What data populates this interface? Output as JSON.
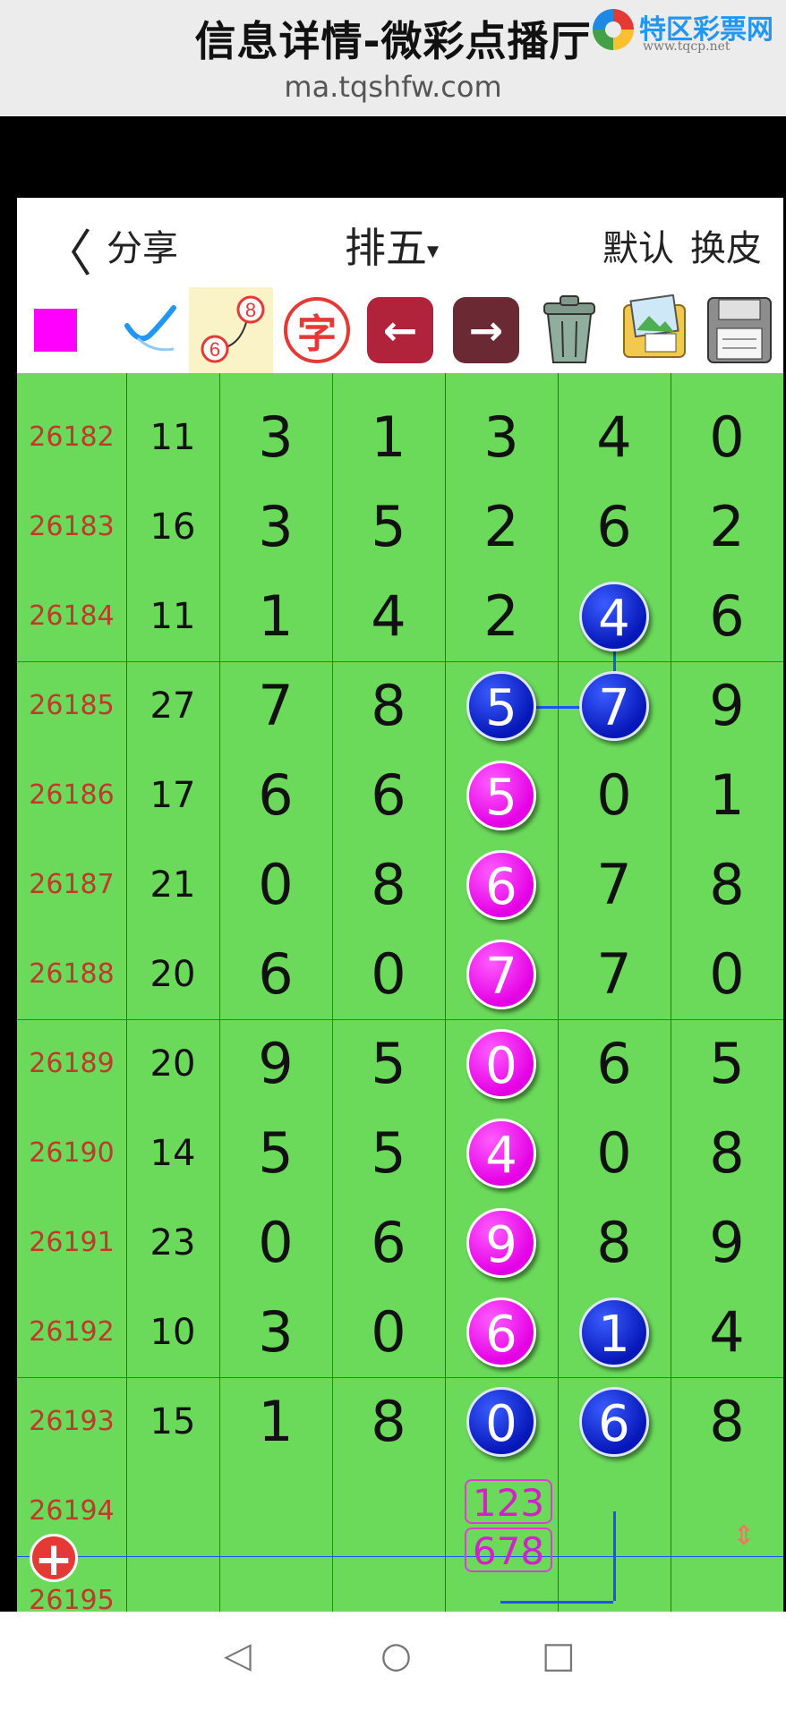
{
  "browser": {
    "title": "信息详情-微彩点播厅",
    "url": "ma.tqshfw.com",
    "logo_text": "特区彩票网",
    "logo_sub": "www.tqcp.net"
  },
  "header": {
    "back_symbol": "〈",
    "share_label": "分享",
    "game_label": "排五",
    "game_caret": "▾",
    "default_label": "默认",
    "skin_label": "换皮"
  },
  "toolbar": {
    "curve_top": "8",
    "curve_bottom": "6",
    "zi_label": "字",
    "prev_symbol": "←",
    "next_symbol": "→",
    "brush_symbol": "✎",
    "trash_symbol": "🗑",
    "photo_symbol": "🖼",
    "save_symbol": "💾"
  },
  "rows": [
    {
      "issue": "26182",
      "sum": "11",
      "digits": [
        "3",
        "1",
        "3",
        "4",
        "0"
      ]
    },
    {
      "issue": "26183",
      "sum": "16",
      "digits": [
        "3",
        "5",
        "2",
        "6",
        "2"
      ]
    },
    {
      "issue": "26184",
      "sum": "11",
      "digits": [
        "1",
        "4",
        "2",
        "4",
        "6"
      ]
    },
    {
      "issue": "26185",
      "sum": "27",
      "digits": [
        "7",
        "8",
        "5",
        "7",
        "9"
      ]
    },
    {
      "issue": "26186",
      "sum": "17",
      "digits": [
        "6",
        "6",
        "5",
        "0",
        "1"
      ]
    },
    {
      "issue": "26187",
      "sum": "21",
      "digits": [
        "0",
        "8",
        "6",
        "7",
        "8"
      ]
    },
    {
      "issue": "26188",
      "sum": "20",
      "digits": [
        "6",
        "0",
        "7",
        "7",
        "0"
      ]
    },
    {
      "issue": "26189",
      "sum": "20",
      "digits": [
        "9",
        "5",
        "0",
        "6",
        "5"
      ]
    },
    {
      "issue": "26190",
      "sum": "14",
      "digits": [
        "5",
        "5",
        "4",
        "0",
        "8"
      ]
    },
    {
      "issue": "26191",
      "sum": "23",
      "digits": [
        "0",
        "6",
        "9",
        "8",
        "9"
      ]
    },
    {
      "issue": "26192",
      "sum": "10",
      "digits": [
        "3",
        "0",
        "6",
        "1",
        "4"
      ]
    },
    {
      "issue": "26193",
      "sum": "15",
      "digits": [
        "1",
        "8",
        "0",
        "6",
        "8"
      ]
    },
    {
      "issue": "26194",
      "sum": "",
      "digits": [
        "",
        "",
        "",
        "",
        ""
      ]
    },
    {
      "issue": "26195",
      "sum": "",
      "digits": [
        "",
        "",
        "",
        "",
        ""
      ]
    }
  ],
  "prediction": {
    "line1": "123",
    "line2": "678"
  },
  "add_button_symbol": "+",
  "scroll_symbol": "⇕",
  "system_nav": {
    "back": "◁",
    "home": "○",
    "recent": "□"
  },
  "colors": {
    "grid_bg": "#6bd95a",
    "ball_blue": "#0617b8",
    "ball_magenta": "#e400e4",
    "issue_text": "#c0392b",
    "red_line": "#c0392b",
    "blue_line": "#1e50ff"
  }
}
